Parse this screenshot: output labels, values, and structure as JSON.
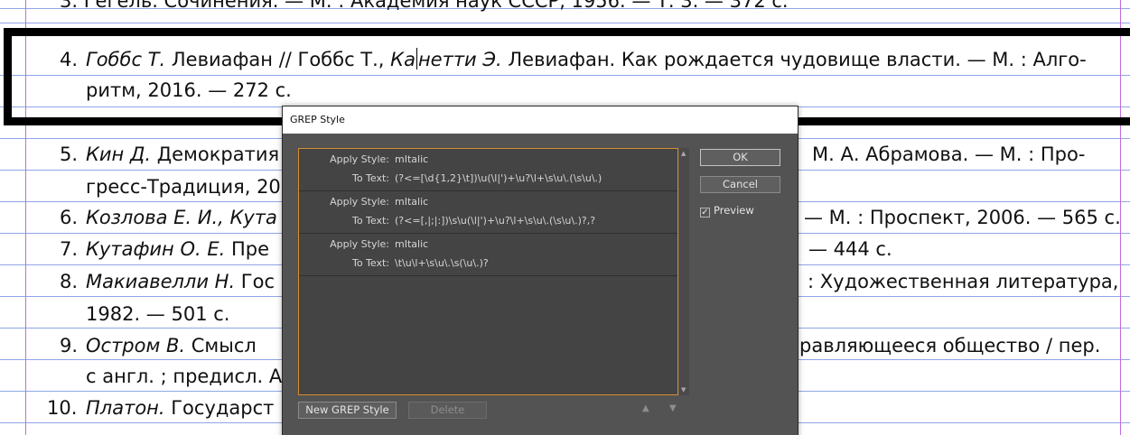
{
  "document": {
    "top_fragment": "3. Гегель. Сочинения. — М. : Академия наук СССР, 1956. — Т. 3. — 372 с.",
    "entries": [
      {
        "number": "4.",
        "author": "Гоббс Т.",
        "line1_mid": " Левиафан // Гоббс Т., ",
        "line1_it2": "Канетти Э.",
        "line1_end": " Левиафан. Как рождается чудовище власти. — М. : Алго-",
        "line2": "ритм, 2016. — 272 с."
      },
      {
        "number": "5.",
        "author": "Кин Д.",
        "line1_left": " Демократия",
        "line1_right": "М. А. Абрамова. — М. : Про-",
        "line2": "гресс-Традиция, 200"
      },
      {
        "number": "6.",
        "author": "Козлова Е. И., Кута",
        "line1_right": "— М. : Проспект, 2006. — 565 с."
      },
      {
        "number": "7.",
        "author": "Кутафин О. Е.",
        "line1_left": " Пре",
        "line1_right": "— 444 с."
      },
      {
        "number": "8.",
        "author": "Макиавелли Н.",
        "line1_left": " Гос",
        "line1_right": ": Художественная литература,",
        "line2": "1982. — 501 с."
      },
      {
        "number": "9.",
        "author": "Остром В.",
        "line1_left": " Смысл",
        "line1_right": "равляющееся общество / пер.",
        "line2": "с англ. ; предисл. А"
      },
      {
        "number": "10.",
        "author": "Платон.",
        "line1_left": " Государст"
      }
    ]
  },
  "dialog": {
    "title": "GREP Style",
    "apply_style_label": "Apply Style:",
    "to_text_label": "To Text:",
    "rules": [
      {
        "style": "mItalic",
        "text": "(?<=[\\d{1,2}\\t])\\u(\\l|')+\\u?\\l+\\s\\u\\.(\\s\\u\\.)"
      },
      {
        "style": "mItalic",
        "text": "(?<=[,|;|:])\\s\\u(\\l|')+\\u?\\l+\\s\\u\\.(\\s\\u\\.)?,?"
      },
      {
        "style": "mItalic",
        "text": "\\t\\u\\l+\\s\\u\\.\\s(\\u\\.)?"
      }
    ],
    "ok_label": "OK",
    "cancel_label": "Cancel",
    "preview_label": "Preview",
    "preview_checked": true,
    "preview_check_glyph": "✓",
    "new_grep_label": "New GREP Style",
    "delete_label": "Delete",
    "move_up_glyph": "▲",
    "move_down_glyph": "▼",
    "scroll_up_glyph": "▲",
    "scroll_down_glyph": "▼"
  },
  "colors": {
    "dialog_bg": "#535353",
    "list_bg": "#444444",
    "list_border": "#d78d32",
    "baseline_grid": "#8fa6e8",
    "margin_guide": "#c36bd9"
  }
}
